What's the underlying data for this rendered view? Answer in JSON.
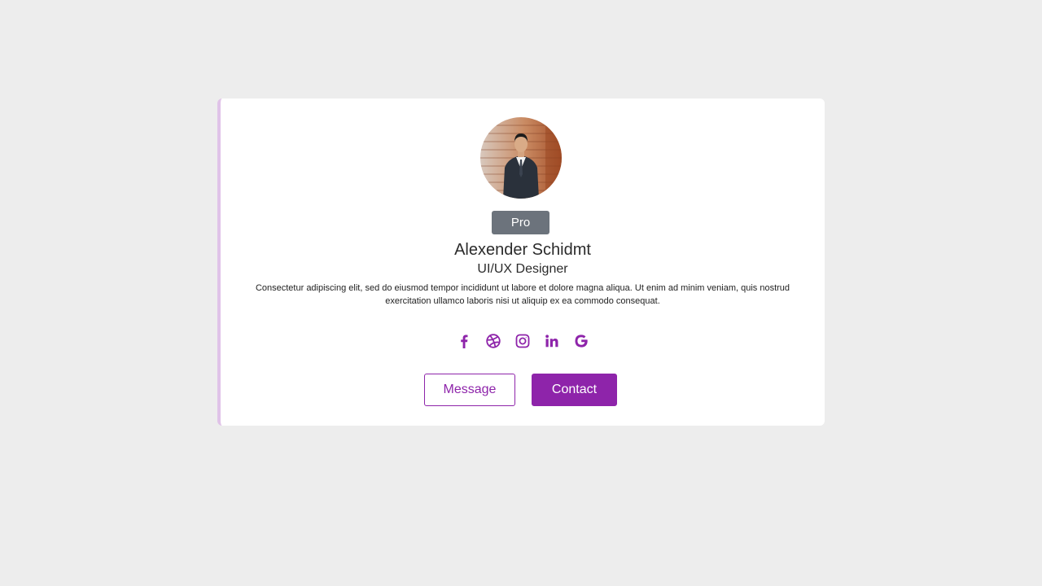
{
  "profile": {
    "badge": "Pro",
    "name": "Alexender Schidmt",
    "role": "UI/UX Designer",
    "bio": "Consectetur adipiscing elit, sed do eiusmod tempor incididunt ut labore et dolore magna aliqua. Ut enim ad minim veniam, quis nostrud exercitation ullamco laboris nisi ut aliquip ex ea commodo consequat."
  },
  "socials": [
    {
      "icon": "facebook-icon"
    },
    {
      "icon": "dribbble-icon"
    },
    {
      "icon": "instagram-icon"
    },
    {
      "icon": "linkedin-icon"
    },
    {
      "icon": "google-icon"
    }
  ],
  "actions": {
    "message_label": "Message",
    "contact_label": "Contact"
  },
  "colors": {
    "accent": "#8e24aa",
    "badge_bg": "#6c737c",
    "background": "#ededed",
    "card_border": "#e0c3e8"
  }
}
